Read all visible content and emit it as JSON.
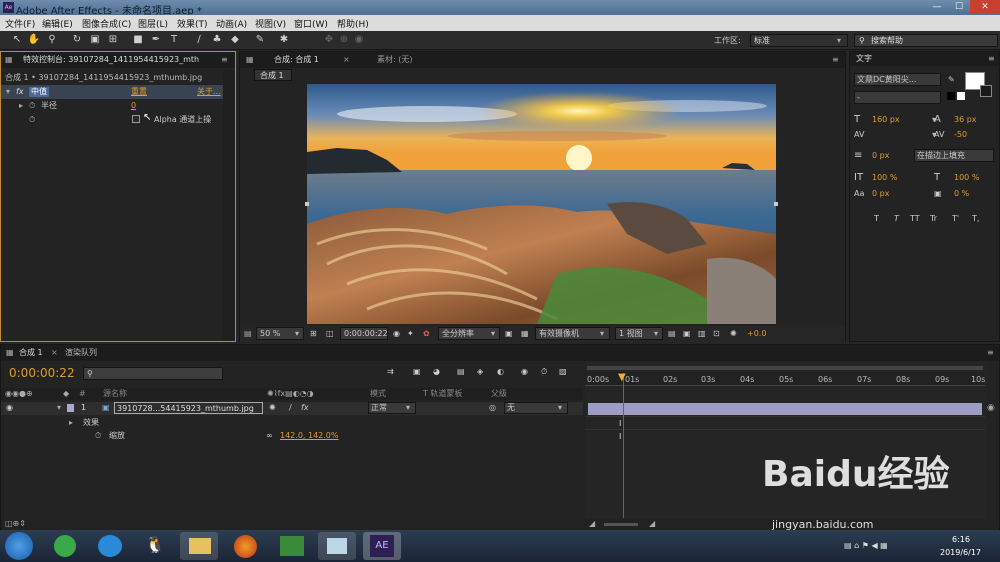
{
  "window": {
    "title": "Adobe After Effects - 未命名项目.aep *",
    "logo": "Ae"
  },
  "menu": [
    "文件(F)",
    "编辑(E)",
    "图像合成(C)",
    "图层(L)",
    "效果(T)",
    "动画(A)",
    "视图(V)",
    "窗口(W)",
    "帮助(H)"
  ],
  "toolbar": {
    "workspace_label": "工作区:",
    "workspace_value": "标准",
    "search_placeholder": "搜索帮助"
  },
  "effects_panel": {
    "tab": "特效控制台: 39107284_1411954415923_mth",
    "breadcrumb": "合成 1 • 39107284_1411954415923_mthumb.jpg",
    "fx_label": "fx",
    "effect_name": "中值",
    "reset": "重置",
    "about": "关于...",
    "param_radius": "半径",
    "param_radius_value": "0",
    "checkbox_label": "Alpha 通道上操"
  },
  "comp_panel": {
    "tab": "合成: 合成 1",
    "footage_tab": "素材: (无)",
    "subtab": "合成 1",
    "zoom": "50 %",
    "timecode": "0:00:00:22",
    "resolution": "全分辨率",
    "camera": "有效摄像机",
    "views": "1 视图",
    "offset": "+0.0"
  },
  "text_panel": {
    "tab": "文字",
    "font": "文鼎DC黄阳尖...",
    "font_style": "-",
    "size": "160 px",
    "leading": "36 px",
    "tracking_val": "-50",
    "stroke": "0 px",
    "stroke_mode": "在描边上填充",
    "vscale": "100 %",
    "hscale": "100 %",
    "baseline": "0 px",
    "tsume": "0 %",
    "styles": [
      "T",
      "T",
      "TT",
      "Tr",
      "T'",
      "T,"
    ]
  },
  "timeline": {
    "tab": "合成 1",
    "render_tab": "渲染队列",
    "timecode": "0:00:00:22",
    "col_source": "源名称",
    "col_mode": "模式",
    "col_trkmat": "T  轨道蒙板",
    "col_parent": "父级",
    "layer_num": "1",
    "layer_name": "3910728...54415923_mthumb.jpg",
    "layer_mode": "正常",
    "layer_parent": "无",
    "effects_label": "效果",
    "scale_label": "缩放",
    "scale_value": "142.0, 142.0%",
    "ruler": [
      "0:00s",
      "01s",
      "02s",
      "03s",
      "04s",
      "05s",
      "06s",
      "07s",
      "08s",
      "09s",
      "10s"
    ]
  },
  "taskbar": {
    "time": "6:16",
    "date": "2019/6/17",
    "ae_label": "AE"
  },
  "watermark": {
    "main": "Baidu经验",
    "url": "jingyan.baidu.com"
  }
}
